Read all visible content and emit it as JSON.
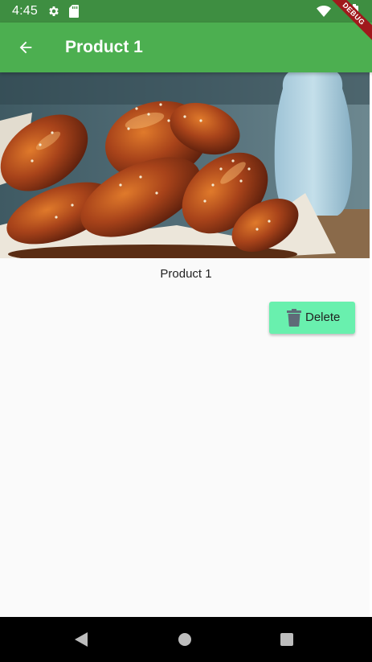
{
  "status_bar": {
    "time": "4:45",
    "debug_label": "DEBUG",
    "icons": [
      "gear-icon",
      "sd-card-icon",
      "wifi-icon",
      "battery-icon"
    ]
  },
  "app_bar": {
    "title": "Product 1",
    "back_icon": "arrow-left-icon",
    "background_color": "#4caf50",
    "status_color": "#3e8e41"
  },
  "product": {
    "image_subject": "product-photo",
    "name": "Product 1"
  },
  "actions": {
    "delete_label": "Delete",
    "delete_icon": "trash-icon",
    "delete_color": "#69f0ae"
  },
  "nav_bar": {
    "icons": [
      "nav-back-icon",
      "nav-home-icon",
      "nav-recents-icon"
    ]
  }
}
